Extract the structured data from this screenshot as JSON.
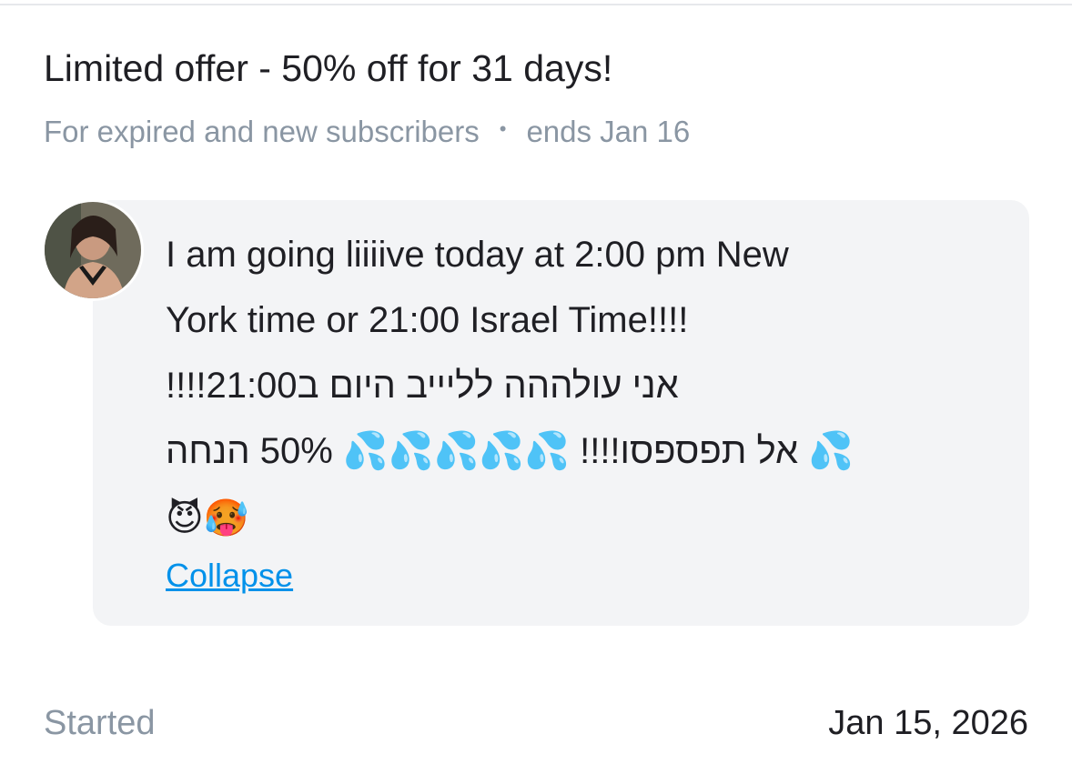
{
  "offer": {
    "title": "Limited offer - 50% off for 31 days!",
    "audience": "For expired and new subscribers",
    "separator": "•",
    "ends": "ends Jan 16"
  },
  "message": {
    "avatar_icon": "profile-photo-avatar",
    "line1": "I am going liiiive today at 2:00 pm New",
    "line2": "York time or 21:00 Israel Time!!!!",
    "line3": "אני עולההה לליייב היום ב21:00!!!!",
    "line4_hebrew": "אל תפספסו!!!!",
    "line4_percent": "50% הנחה",
    "emoji_drops": "💦",
    "emoji_devil": "😈",
    "emoji_hot": "🥵",
    "collapse_label": "Collapse"
  },
  "footer": {
    "started_label": "Started",
    "started_date": "Jan 15, 2026"
  },
  "colors": {
    "accent_link": "#0091ea",
    "muted_text": "#8a96a3",
    "bubble_bg": "#f3f4f6"
  }
}
